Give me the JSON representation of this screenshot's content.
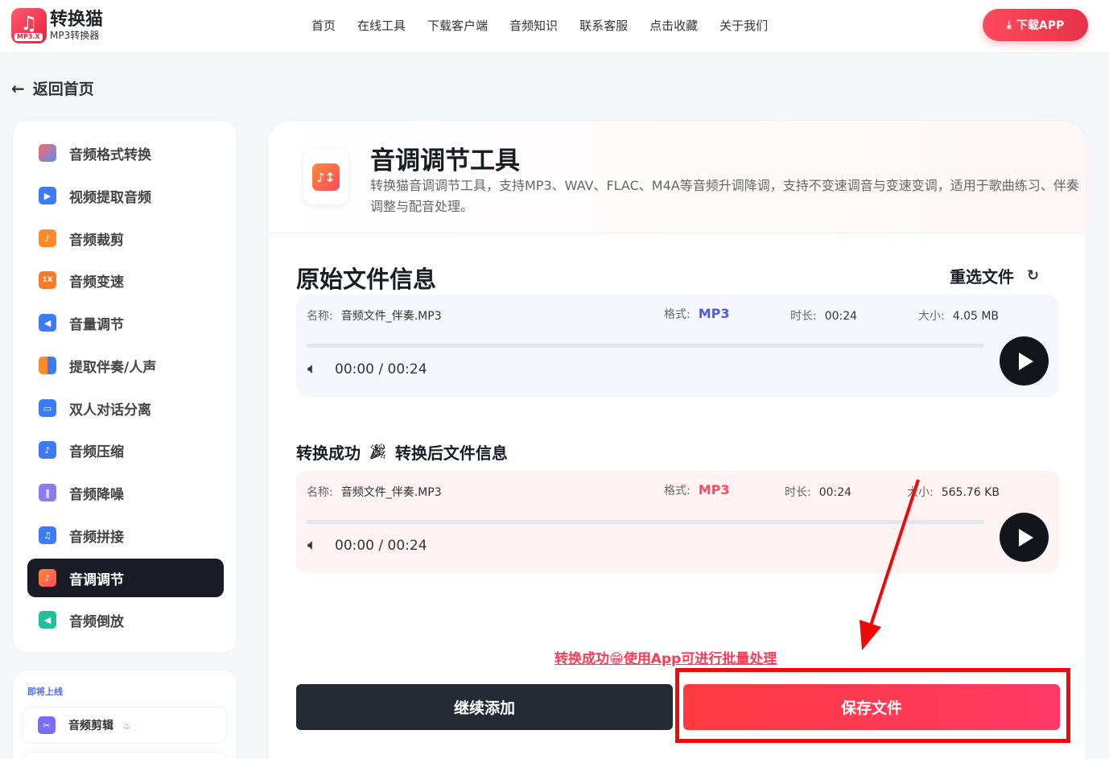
{
  "header": {
    "logo_name": "转换猫",
    "logo_sub": "MP3转换器",
    "logo_tag": "MP3.X",
    "nav": [
      "首页",
      "在线工具",
      "下载客户端",
      "音频知识",
      "联系客服",
      "点击收藏",
      "关于我们"
    ],
    "download_label": "下载APP"
  },
  "back_label": "返回首页",
  "sidebar": {
    "items": [
      {
        "label": "音频格式转换",
        "icon": "format-convert-icon",
        "color": "#ff5a5a"
      },
      {
        "label": "视频提取音频",
        "icon": "video-extract-icon",
        "color": "#3b7cf6"
      },
      {
        "label": "音频裁剪",
        "icon": "audio-cut-icon",
        "color": "#ff8a2a"
      },
      {
        "label": "音频变速",
        "icon": "speed-icon",
        "color": "#ff7a2a"
      },
      {
        "label": "音量调节",
        "icon": "volume-icon",
        "color": "#3b7cf6"
      },
      {
        "label": "提取伴奏/人声",
        "icon": "vocal-extract-icon",
        "color": "#ff8a2a"
      },
      {
        "label": "双人对话分离",
        "icon": "dialog-split-icon",
        "color": "#3b7cf6"
      },
      {
        "label": "音频压缩",
        "icon": "compress-icon",
        "color": "#3b7cf6"
      },
      {
        "label": "音频降噪",
        "icon": "denoise-icon",
        "color": "#7a6cf6"
      },
      {
        "label": "音频拼接",
        "icon": "merge-icon",
        "color": "#3b7cf6"
      },
      {
        "label": "音调调节",
        "icon": "pitch-icon",
        "color": "#ff5a4a"
      },
      {
        "label": "音频倒放",
        "icon": "reverse-icon",
        "color": "#1fc0a0"
      }
    ],
    "soon_title": "即将上线",
    "soon_item": "音频剪辑"
  },
  "tool": {
    "title": "音调调节工具",
    "desc": "转换猫音调调节工具，支持MP3、WAV、FLAC、M4A等音频升调降调，支持不变速调音与变速变调，适用于歌曲练习、伴奏调整与配音处理。"
  },
  "original": {
    "section_title": "原始文件信息",
    "reselect_label": "重选文件",
    "name_label": "名称:",
    "name": "音频文件_伴奏.MP3",
    "format_label": "格式:",
    "format": "MP3",
    "duration_label": "时长:",
    "duration": "00:24",
    "size_label": "大小:",
    "size": "4.05 MB",
    "time": "00:00 / 00:24",
    "progress": 0
  },
  "converted": {
    "section_title_a": "转换成功",
    "section_title_b": "转换后文件信息",
    "name_label": "名称:",
    "name": "音频文件_伴奏.MP3",
    "format_label": "格式:",
    "format": "MP3",
    "duration_label": "时长:",
    "duration": "00:24",
    "size_label": "大小:",
    "size": "565.76 KB",
    "time": "00:00 / 00:24",
    "progress": 0
  },
  "promo": "转换成功😁使用App可进行批量处理",
  "actions": {
    "continue_label": "继续添加",
    "save_label": "保存文件"
  },
  "colors": {
    "accent": "#ff3a56",
    "dark": "#252a33",
    "annotation": "#ee0a0a"
  }
}
